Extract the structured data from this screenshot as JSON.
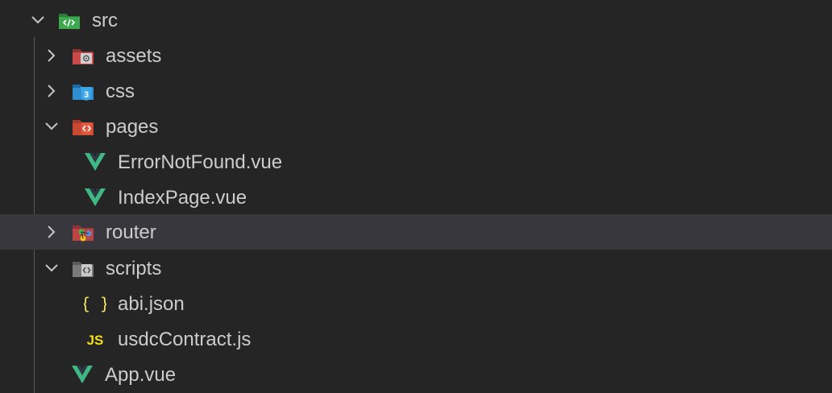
{
  "explorer": {
    "tree": [
      {
        "label": "src",
        "expanded": true,
        "icon": "src-folder-icon"
      },
      {
        "label": "assets",
        "expanded": false,
        "icon": "assets-folder-icon"
      },
      {
        "label": "css",
        "expanded": false,
        "icon": "css-folder-icon"
      },
      {
        "label": "pages",
        "expanded": true,
        "icon": "pages-folder-icon"
      },
      {
        "label": "ErrorNotFound.vue",
        "icon": "vue-icon"
      },
      {
        "label": "IndexPage.vue",
        "icon": "vue-icon"
      },
      {
        "label": "router",
        "expanded": false,
        "icon": "router-folder-icon",
        "hovered": true
      },
      {
        "label": "scripts",
        "expanded": true,
        "icon": "scripts-folder-icon"
      },
      {
        "label": "abi.json",
        "icon": "json-icon"
      },
      {
        "label": "usdcContract.js",
        "icon": "js-icon"
      },
      {
        "label": "App.vue",
        "icon": "vue-icon"
      }
    ]
  },
  "colors": {
    "background": "#252526",
    "hover_row": "#37373d",
    "text": "#cccccc",
    "vue_green": "#41b883",
    "json_yellow": "#f1e05a",
    "js_yellow": "#f5de19",
    "css_blue": "#2f8fcf",
    "src_green": "#3ea84f",
    "pages_orange": "#e2583e",
    "assets_red": "#c74b4b"
  }
}
